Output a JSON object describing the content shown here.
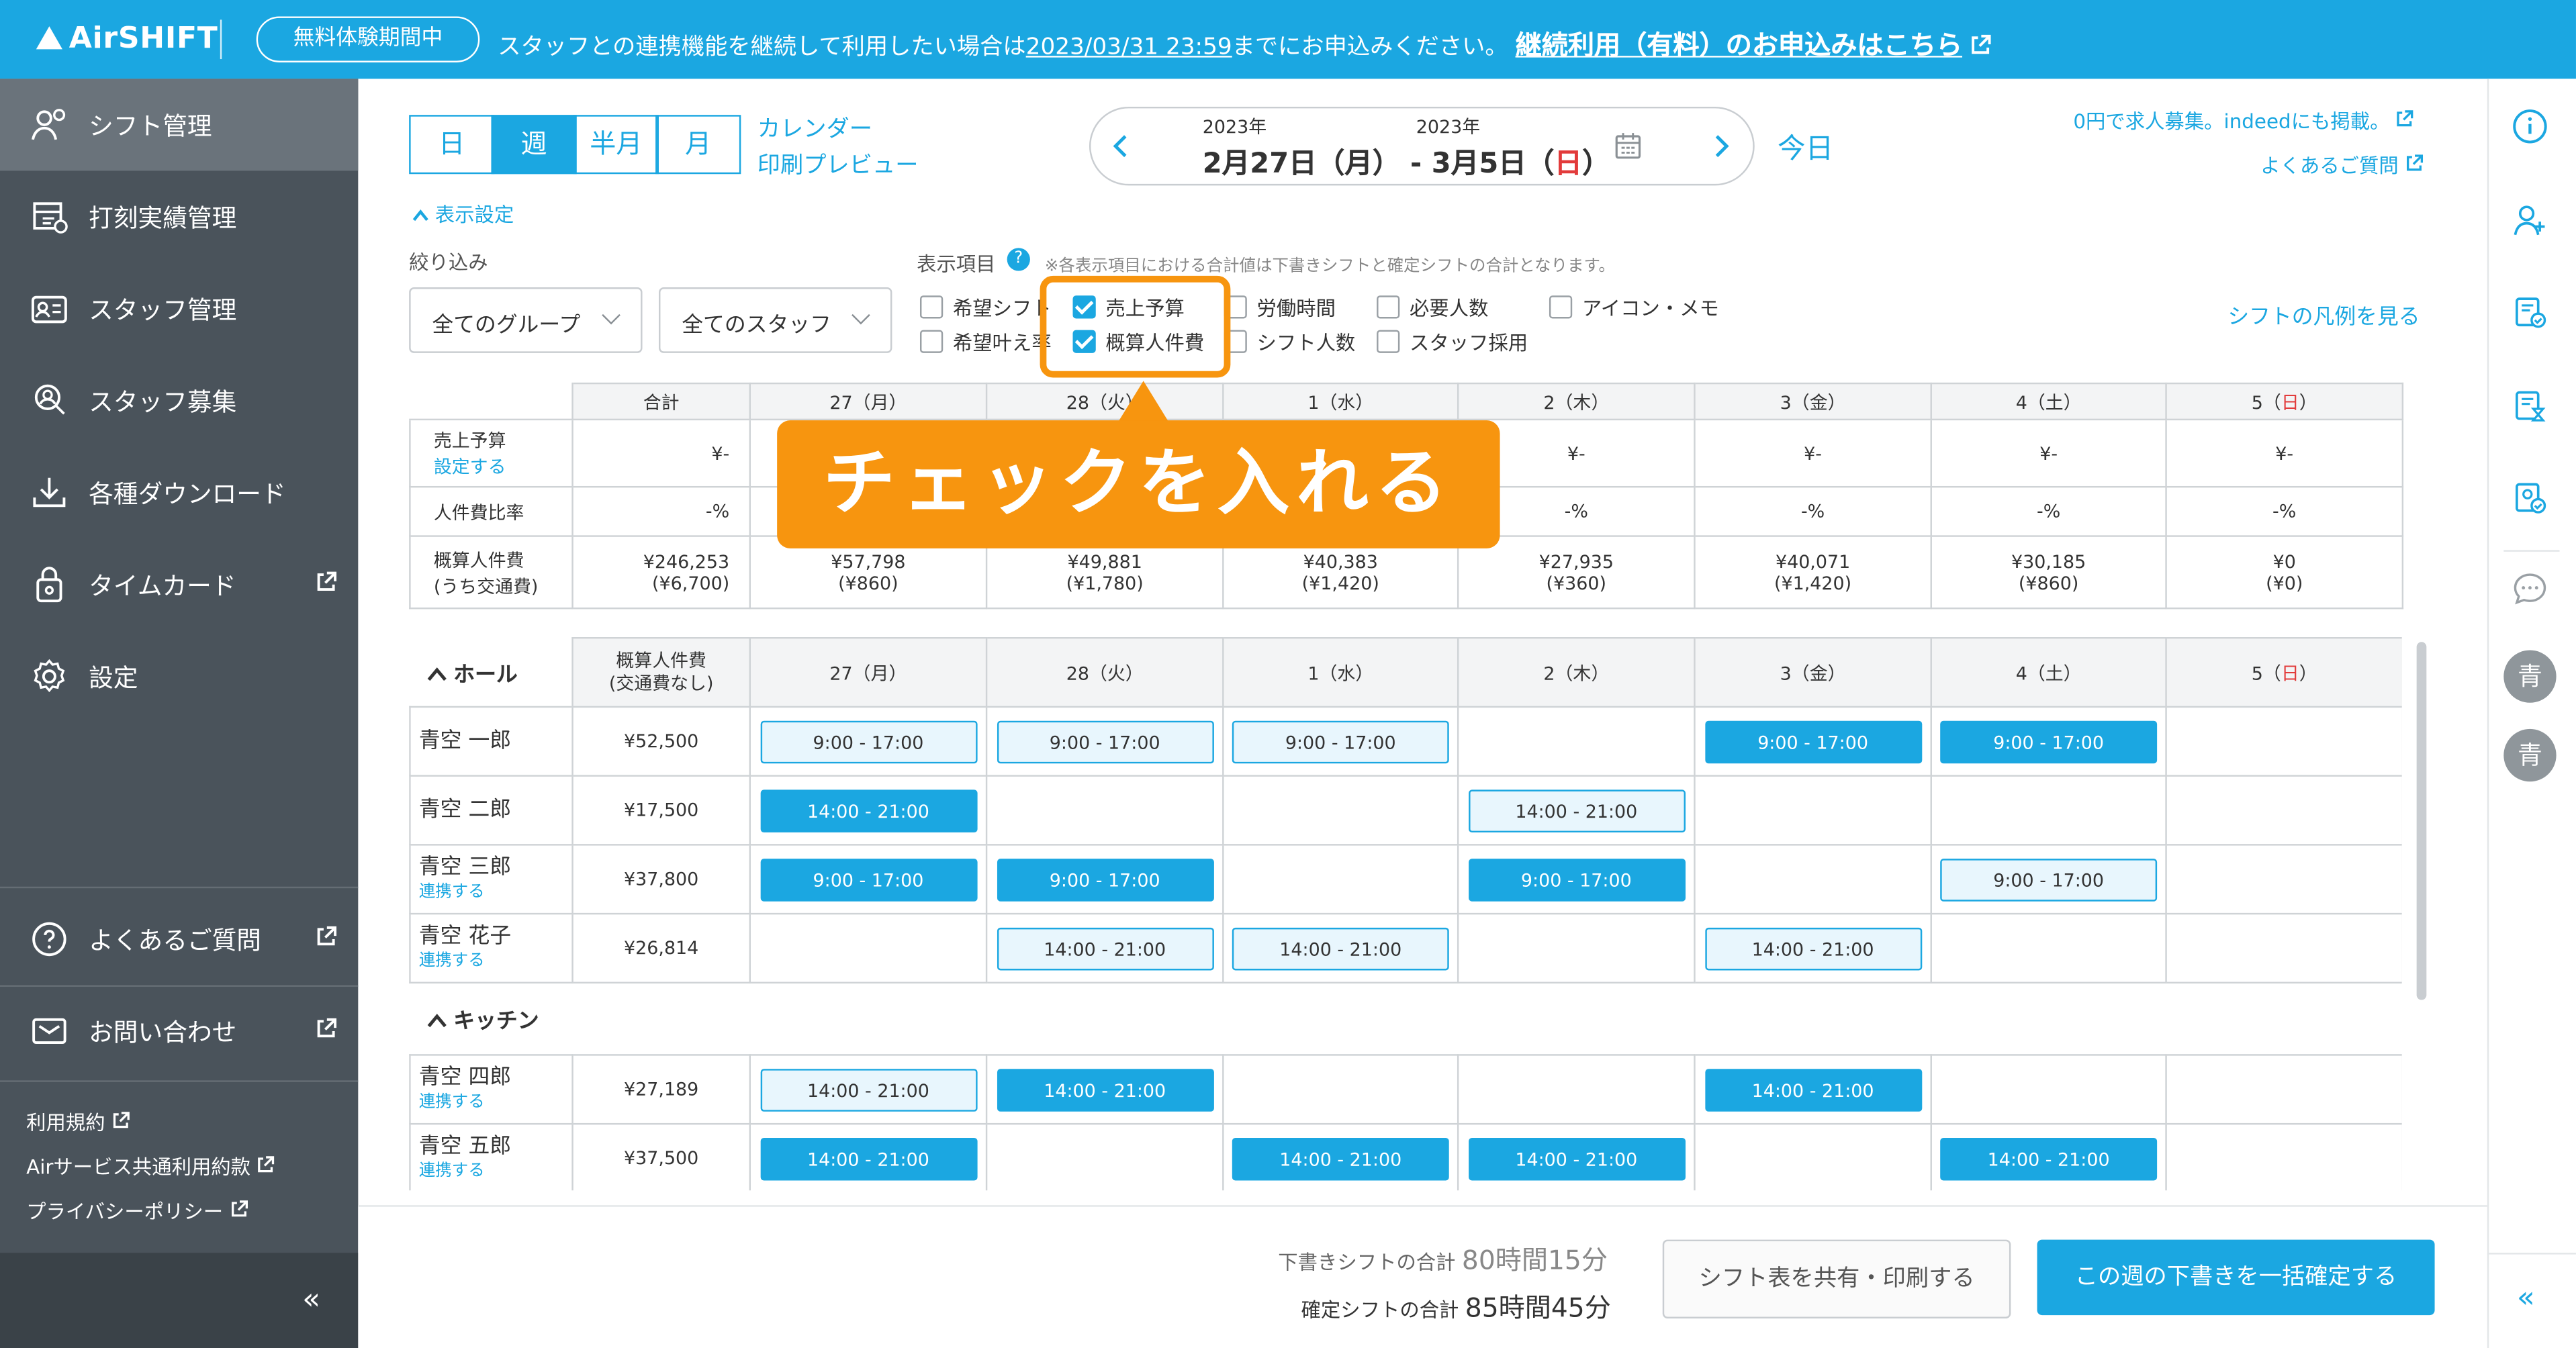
{
  "header": {
    "logo": "AirSHIFT",
    "trial_badge": "無料体験期間中",
    "notice_prefix": "スタッフとの連携機能を継続して利用したい場合は",
    "notice_date": "2023/03/31 23:59",
    "notice_mid": "までにお申込みください。",
    "notice_link": "継続利用（有料）のお申込みはこちら"
  },
  "sidebar": {
    "items": [
      {
        "label": "シフト管理"
      },
      {
        "label": "打刻実績管理"
      },
      {
        "label": "スタッフ管理"
      },
      {
        "label": "スタッフ募集"
      },
      {
        "label": "各種ダウンロード"
      },
      {
        "label": "タイムカード"
      },
      {
        "label": "設定"
      }
    ],
    "faq": "よくあるご質問",
    "contact": "お問い合わせ",
    "terms": "利用規約",
    "air_terms": "Airサービス共通利用約款",
    "privacy": "プライバシーポリシー",
    "collapse": "«"
  },
  "toolbar": {
    "view_tabs": [
      "日",
      "週",
      "半月",
      "月"
    ],
    "calendar_print_1": "カレンダー",
    "calendar_print_2": "印刷プレビュー",
    "year_start": "2023年",
    "year_end": "2023年",
    "date_start": "2月27日（月）",
    "date_sep": "-",
    "date_end_prefix": "3月5日（",
    "date_end_day": "日",
    "date_end_suffix": "）",
    "today": "今日",
    "recruit_link": "0円で求人募集。indeedにも掲載。",
    "faq_link": "よくあるご質問"
  },
  "display_settings": {
    "toggle": "表示設定",
    "filter_label": "絞り込み",
    "items_label": "表示項目",
    "note": "※各表示項目における合計値は下書きシフトと確定シフトの合計となります。",
    "group_select": "全てのグループ",
    "staff_select": "全てのスタッフ",
    "options_row1": [
      {
        "label": "希望シフト",
        "checked": false
      },
      {
        "label": "売上予算",
        "checked": true
      },
      {
        "label": "労働時間",
        "checked": false
      },
      {
        "label": "必要人数",
        "checked": false
      },
      {
        "label": "アイコン・メモ",
        "checked": false
      }
    ],
    "options_row2": [
      {
        "label": "希望叶え率",
        "checked": false
      },
      {
        "label": "概算人件費",
        "checked": true
      },
      {
        "label": "シフト人数",
        "checked": false
      },
      {
        "label": "スタッフ採用",
        "checked": false
      }
    ],
    "legend_link": "シフトの凡例を見る"
  },
  "summary": {
    "columns": [
      "合計",
      "27（月）",
      "28（火）",
      "1（水）",
      "2（木）",
      "3（金）",
      "4（土）",
      "5（日）"
    ],
    "rows": [
      {
        "label": "売上予算",
        "sub": "設定する",
        "values": [
          "¥-",
          "¥-",
          "¥-",
          "¥-",
          "¥-",
          "¥-",
          "¥-",
          "¥-"
        ]
      },
      {
        "label": "人件費比率",
        "sub": "",
        "values": [
          "-%",
          "-%",
          "-%",
          "-%",
          "-%",
          "-%",
          "-%",
          "-%"
        ]
      },
      {
        "label": "概算人件費",
        "sub": "(うち交通費)",
        "values": [
          [
            "¥246,253",
            "(¥6,700)"
          ],
          [
            "¥57,798",
            "(¥860)"
          ],
          [
            "¥49,881",
            "(¥1,780)"
          ],
          [
            "¥40,383",
            "(¥1,420)"
          ],
          [
            "¥27,935",
            "(¥360)"
          ],
          [
            "¥40,071",
            "(¥1,420)"
          ],
          [
            "¥30,185",
            "(¥860)"
          ],
          [
            "¥0",
            "(¥0)"
          ]
        ]
      }
    ]
  },
  "callout": "チェックを入れる",
  "schedule": {
    "cost_header_1": "概算人件費",
    "cost_header_2": "(交通費なし)",
    "days": [
      "27（月）",
      "28（火）",
      "1（水）",
      "2（木）",
      "3（金）",
      "4（土）",
      "5（日）"
    ],
    "groups": [
      {
        "name": "ホール",
        "staff": [
          {
            "name": "青空 一郎",
            "link": "",
            "cost": "¥52,500",
            "shifts": [
              [
                "9:00 - 17:00",
                "d"
              ],
              [
                "9:00 - 17:00",
                "d"
              ],
              [
                "9:00 - 17:00",
                "d"
              ],
              null,
              [
                "9:00 - 17:00",
                "c"
              ],
              [
                "9:00 - 17:00",
                "c"
              ],
              null
            ]
          },
          {
            "name": "青空 二郎",
            "link": "",
            "cost": "¥17,500",
            "shifts": [
              [
                "14:00 - 21:00",
                "c"
              ],
              null,
              null,
              [
                "14:00 - 21:00",
                "d"
              ],
              null,
              null,
              null
            ]
          },
          {
            "name": "青空 三郎",
            "link": "連携する",
            "cost": "¥37,800",
            "shifts": [
              [
                "9:00 - 17:00",
                "c"
              ],
              [
                "9:00 - 17:00",
                "c"
              ],
              null,
              [
                "9:00 - 17:00",
                "c"
              ],
              null,
              [
                "9:00 - 17:00",
                "d"
              ],
              null
            ]
          },
          {
            "name": "青空 花子",
            "link": "連携する",
            "cost": "¥26,814",
            "shifts": [
              null,
              [
                "14:00 - 21:00",
                "d"
              ],
              [
                "14:00 - 21:00",
                "d"
              ],
              null,
              [
                "14:00 - 21:00",
                "d"
              ],
              null,
              null
            ]
          }
        ]
      },
      {
        "name": "キッチン",
        "staff": [
          {
            "name": "青空 四郎",
            "link": "連携する",
            "cost": "¥27,189",
            "shifts": [
              [
                "14:00 - 21:00",
                "d"
              ],
              [
                "14:00 - 21:00",
                "c"
              ],
              null,
              null,
              [
                "14:00 - 21:00",
                "c"
              ],
              null,
              null
            ]
          },
          {
            "name": "青空 五郎",
            "link": "連携する",
            "cost": "¥37,500",
            "shifts": [
              [
                "14:00 - 21:00",
                "c"
              ],
              null,
              [
                "14:00 - 21:00",
                "c"
              ],
              [
                "14:00 - 21:00",
                "c"
              ],
              null,
              [
                "14:00 - 21:00",
                "c"
              ],
              null
            ]
          }
        ]
      }
    ]
  },
  "footer": {
    "draft_label": "下書きシフトの合計",
    "draft_value": "80時間15分",
    "confirmed_label": "確定シフトの合計",
    "confirmed_value": "85時間45分",
    "share_button": "シフト表を共有・印刷する",
    "confirm_button": "この週の下書きを一括確定する"
  },
  "rightbar": {
    "avatar_1": "青",
    "avatar_2": "青",
    "collapse": "«"
  },
  "colors": {
    "accent": "#1ba7e1",
    "sidebar": "#4a535b",
    "callout": "#f7950f",
    "sunday": "#e23b3b"
  }
}
